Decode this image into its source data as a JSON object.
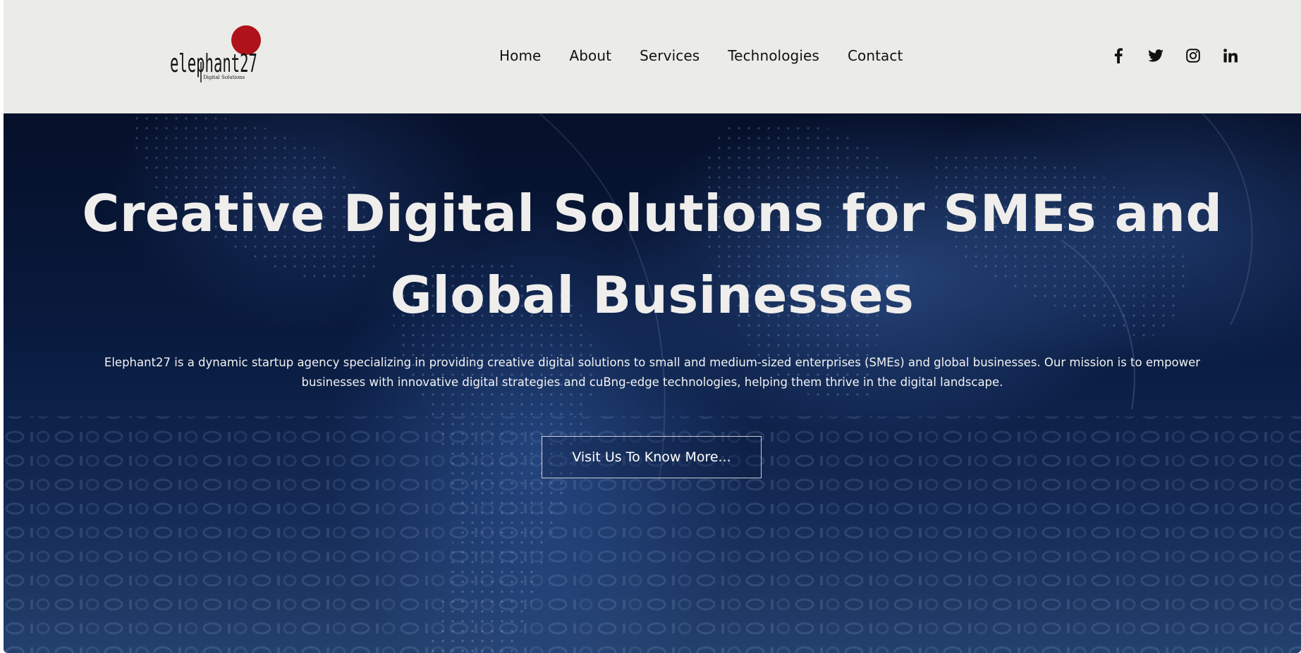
{
  "brand": {
    "name": "elephant27",
    "tagline": "Digital Solutions",
    "accent_color": "#b0121b"
  },
  "nav": {
    "items": [
      {
        "label": "Home"
      },
      {
        "label": "About"
      },
      {
        "label": "Services"
      },
      {
        "label": "Technologies"
      },
      {
        "label": "Contact"
      }
    ]
  },
  "socials": [
    {
      "icon": "facebook-icon"
    },
    {
      "icon": "twitter-icon"
    },
    {
      "icon": "instagram-icon"
    },
    {
      "icon": "linkedin-icon"
    }
  ],
  "hero": {
    "title_line1": "Creative Digital Solutions for SMEs and",
    "title_line2": "Global Businesses",
    "description": "Elephant27 is a dynamic startup agency specializing in providing creative digital solutions to small and medium-sized enterprises (SMEs) and global businesses. Our mission is to empower businesses with innovative digital strategies and cuBng-edge technologies, helping them thrive in the digital landscape.",
    "cta_label": "Visit Us To Know More...",
    "background_color": "#0c2350"
  }
}
